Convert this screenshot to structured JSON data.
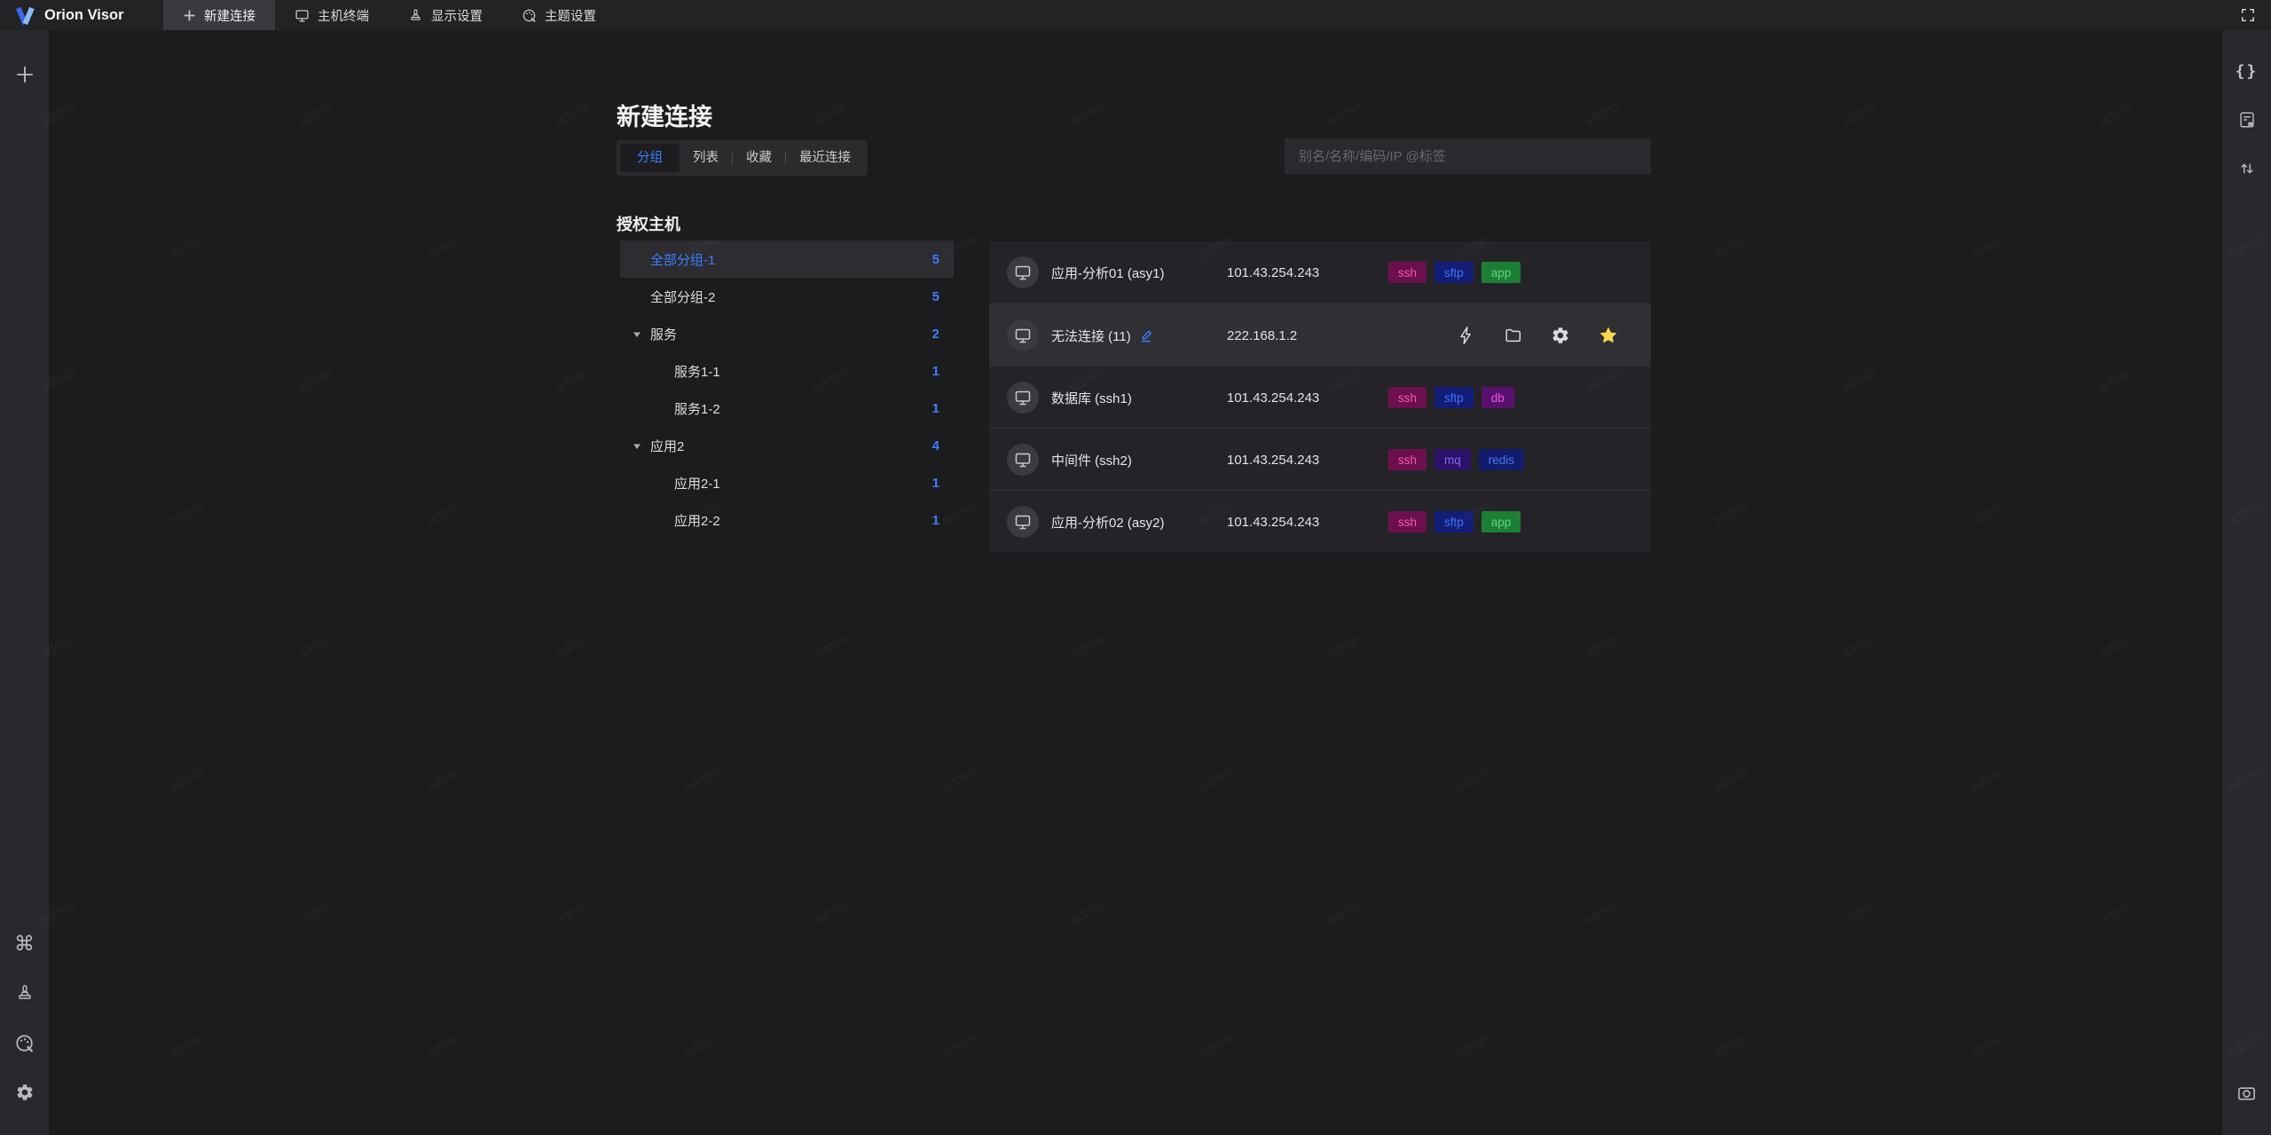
{
  "app": {
    "name": "Orion Visor"
  },
  "topbar": {
    "tabs": [
      {
        "label": "新建连接"
      },
      {
        "label": "主机终端"
      },
      {
        "label": "显示设置"
      },
      {
        "label": "主题设置"
      }
    ]
  },
  "page": {
    "title": "新建连接",
    "view_tabs": {
      "group": "分组",
      "list": "列表",
      "favorite": "收藏",
      "recent": "最近连接"
    },
    "search_placeholder": "别名/名称/编码/IP @标签",
    "section_title": "授权主机"
  },
  "tree": [
    {
      "label": "全部分组-1",
      "count": "5",
      "selected": true
    },
    {
      "label": "全部分组-2",
      "count": "5"
    },
    {
      "label": "服务",
      "count": "2",
      "expandable": true
    },
    {
      "label": "服务1-1",
      "count": "1"
    },
    {
      "label": "服务1-2",
      "count": "1"
    },
    {
      "label": "应用2",
      "count": "4",
      "expandable": true
    },
    {
      "label": "应用2-1",
      "count": "1"
    },
    {
      "label": "应用2-2",
      "count": "1"
    }
  ],
  "hosts": [
    {
      "name": "应用-分析01 (asy1)",
      "ip": "101.43.254.243",
      "tags": [
        "ssh",
        "sftp",
        "app"
      ]
    },
    {
      "name": "无法连接 (11)",
      "ip": "222.168.1.2",
      "tags": [],
      "hovered": true
    },
    {
      "name": "数据库 (ssh1)",
      "ip": "101.43.254.243",
      "tags": [
        "ssh",
        "sftp",
        "db"
      ]
    },
    {
      "name": "中间件 (ssh2)",
      "ip": "101.43.254.243",
      "tags": [
        "ssh",
        "mq",
        "redis"
      ]
    },
    {
      "name": "应用-分析02 (asy2)",
      "ip": "101.43.254.243",
      "tags": [
        "ssh",
        "sftp",
        "app"
      ]
    }
  ],
  "tag_colors": {
    "ssh": {
      "bg": "#6B0F4F",
      "text": "#F75AA9"
    },
    "sftp": {
      "bg": "#131D78",
      "text": "#3D74F6"
    },
    "app": {
      "bg": "#1D7E35",
      "text": "#5ED57C"
    },
    "db": {
      "bg": "#57106B",
      "text": "#EE58E8"
    },
    "mq": {
      "bg": "#2B1169",
      "text": "#8766F2"
    },
    "redis": {
      "bg": "#111C6C",
      "text": "#4A78F0"
    }
  },
  "colors": {
    "accent": "#3C7EFF",
    "star_active": "#F7D94C"
  },
  "icons": {
    "command": "⌘",
    "braces": "{}"
  },
  "watermark": {
    "text": "admin"
  }
}
